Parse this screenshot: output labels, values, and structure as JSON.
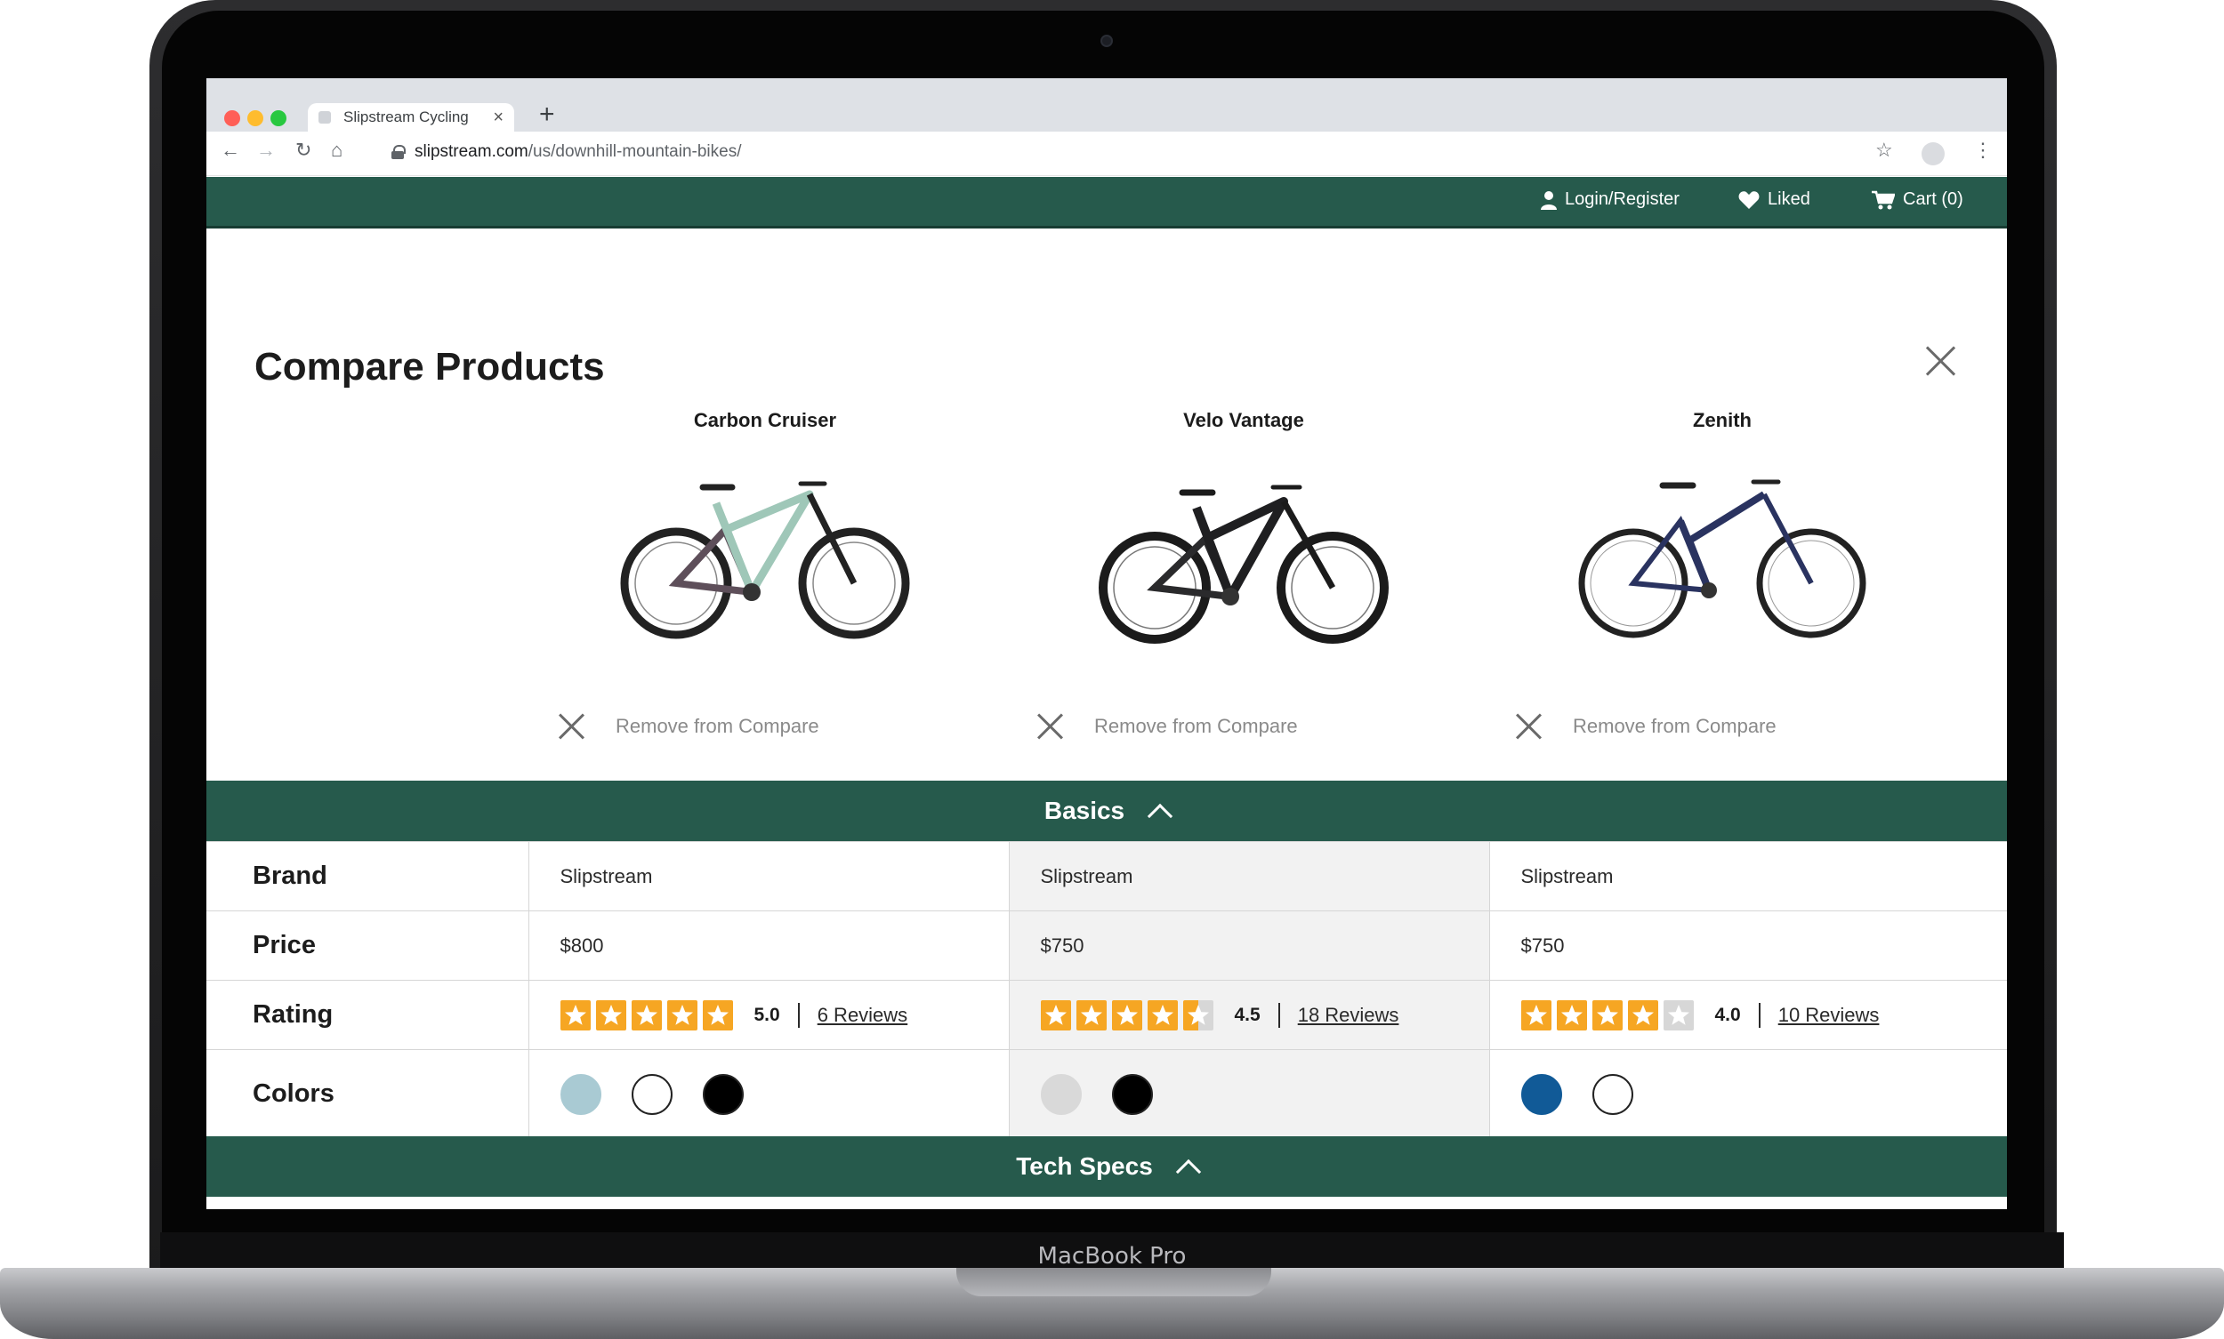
{
  "device": {
    "label": "MacBook Pro"
  },
  "browser": {
    "tab_title": "Slipstream Cycling",
    "tab_close": "×",
    "new_tab": "+",
    "url_host": "slipstream.com",
    "url_path": "/us/downhill-mountain-bikes/"
  },
  "header": {
    "login": "Login/Register",
    "liked": "Liked",
    "cart": "Cart (0)"
  },
  "compare": {
    "title": "Compare Products",
    "remove_label": "Remove from Compare",
    "products": [
      {
        "name": "Carbon Cruiser",
        "frame_color": "#5e4f5a",
        "accent_color": "#9fc7b8"
      },
      {
        "name": "Velo Vantage",
        "frame_color": "#1f1f21",
        "accent_color": "#3a3a3c"
      },
      {
        "name": "Zenith",
        "frame_color": "#2a3360",
        "accent_color": "#7a5c7a"
      }
    ]
  },
  "sections": {
    "basics": "Basics",
    "tech_specs": "Tech Specs"
  },
  "rows": {
    "brand": {
      "label": "Brand",
      "values": [
        "Slipstream",
        "Slipstream",
        "Slipstream"
      ]
    },
    "price": {
      "label": "Price",
      "values": [
        "$800",
        "$750",
        "$750"
      ]
    },
    "rating": {
      "label": "Rating",
      "values": [
        {
          "score": "5.0",
          "stars": 5.0,
          "reviews": "6 Reviews"
        },
        {
          "score": "4.5",
          "stars": 4.5,
          "reviews": "18 Reviews"
        },
        {
          "score": "4.0",
          "stars": 4.0,
          "reviews": "10 Reviews"
        }
      ]
    },
    "colors": {
      "label": "Colors",
      "values": [
        [
          "#a9cad3",
          "#ffffff",
          "#000000"
        ],
        [
          "#d9d9d9",
          "#000000"
        ],
        [
          "#115a97",
          "#ffffff"
        ]
      ]
    }
  },
  "theme": {
    "brand_green": "#265a4c",
    "star_orange": "#f6a623",
    "star_empty": "#d7d7d7"
  }
}
